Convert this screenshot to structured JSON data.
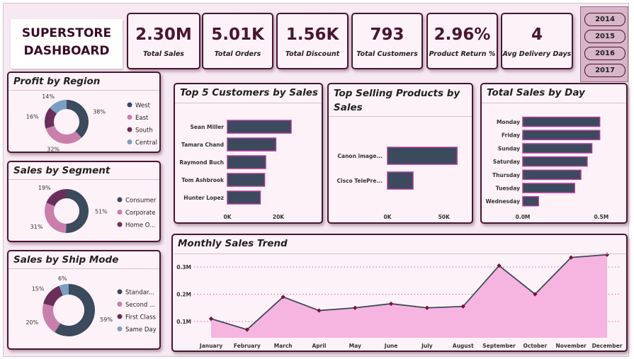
{
  "title_lines": [
    "SUPERSTORE",
    "DASHBOARD"
  ],
  "kpis": [
    {
      "value": "2.30M",
      "label": "Total Sales"
    },
    {
      "value": "5.01K",
      "label": "Total Orders"
    },
    {
      "value": "1.56K",
      "label": "Total Discount"
    },
    {
      "value": "793",
      "label": "Total Customers"
    },
    {
      "value": "2.96%",
      "label": "Product Return %"
    },
    {
      "value": "4",
      "label": "Avg Delivery Days"
    }
  ],
  "years": [
    "2014",
    "2015",
    "2016",
    "2017"
  ],
  "colors": {
    "navy": "#3b4a5d",
    "pink": "#c97fab",
    "purple": "#6a2e5a",
    "steel": "#7b9fc0",
    "maroon": "#4a1531",
    "area": "#f5b5e0",
    "line": "#3f4a5a"
  },
  "chart_data": [
    {
      "type": "pie",
      "title": "Profit by Region",
      "categories": [
        "West",
        "East",
        "South",
        "Central"
      ],
      "values": [
        38,
        32,
        16,
        14
      ],
      "labels": [
        "38%",
        "32%",
        "16%",
        "14%"
      ],
      "legend": "right"
    },
    {
      "type": "pie",
      "title": "Sales by Segment",
      "categories": [
        "Consumer",
        "Corporate",
        "Home O..."
      ],
      "values": [
        51,
        31,
        19
      ],
      "labels": [
        "51%",
        "31%",
        "19%"
      ],
      "legend": "right"
    },
    {
      "type": "pie",
      "title": "Sales by Ship Mode",
      "categories": [
        "Standar...",
        "Second ...",
        "First Class",
        "Same Day"
      ],
      "values": [
        59,
        20,
        15,
        6
      ],
      "labels": [
        "59%",
        "20%",
        "15%",
        "6%"
      ],
      "legend": "right"
    },
    {
      "type": "bar",
      "orientation": "horizontal",
      "title": "Top 5 Customers by Sales",
      "categories": [
        "Sean Miller",
        "Tamara Chand",
        "Raymond Buch",
        "Tom Ashbrook",
        "Hunter Lopez"
      ],
      "values": [
        25000,
        19000,
        15000,
        14600,
        12900
      ],
      "xlim": [
        0,
        25000
      ],
      "xticks": [
        {
          "v": 0,
          "label": "0K"
        },
        {
          "v": 20000,
          "label": "20K"
        }
      ]
    },
    {
      "type": "bar",
      "orientation": "horizontal",
      "title": "Top Selling Products by Sales",
      "categories": [
        "Canon image...",
        "Cisco TelePre..."
      ],
      "values": [
        61600,
        22600
      ],
      "xlim": [
        0,
        64000
      ],
      "xticks": [
        {
          "v": 0,
          "label": "0K"
        },
        {
          "v": 50000,
          "label": "50K"
        }
      ]
    },
    {
      "type": "bar",
      "orientation": "horizontal",
      "title": "Total Sales by Day",
      "categories": [
        "Monday",
        "Friday",
        "Sunday",
        "Saturday",
        "Thursday",
        "Tuesday",
        "Wednesday"
      ],
      "values": [
        490000,
        490000,
        440000,
        410000,
        370000,
        330000,
        100000
      ],
      "xlim": [
        0,
        600000
      ],
      "xticks": [
        {
          "v": 0,
          "label": "0.0M"
        },
        {
          "v": 500000,
          "label": "0.5M"
        }
      ]
    },
    {
      "type": "area",
      "title": "Monthly Sales Trend",
      "x": [
        "January",
        "February",
        "March",
        "April",
        "May",
        "June",
        "July",
        "August",
        "September",
        "October",
        "November",
        "December"
      ],
      "values": [
        110000,
        70000,
        190000,
        140000,
        150000,
        165000,
        150000,
        155000,
        305000,
        200000,
        335000,
        345000
      ],
      "ylim": [
        40000,
        360000
      ],
      "yticks": [
        {
          "v": 100000,
          "label": "0.1M"
        },
        {
          "v": 200000,
          "label": "0.2M"
        },
        {
          "v": 300000,
          "label": "0.3M"
        }
      ],
      "grid": true
    }
  ]
}
